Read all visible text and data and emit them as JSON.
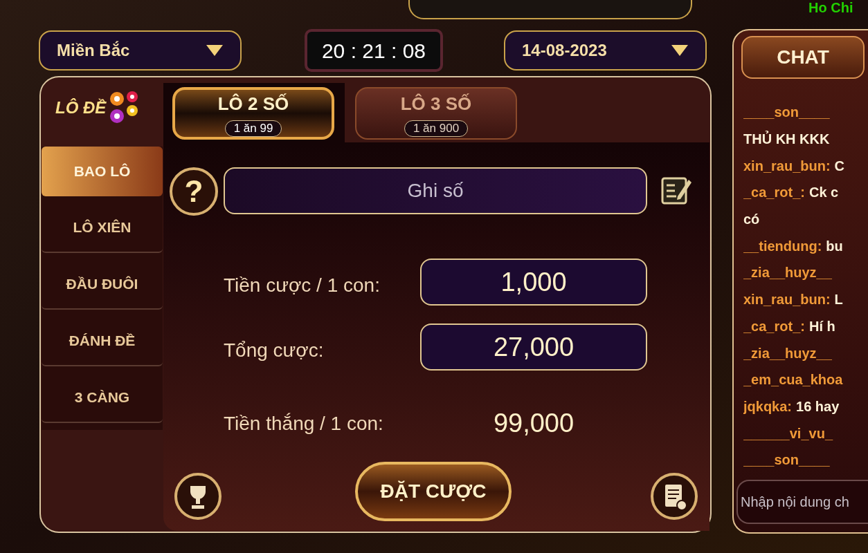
{
  "header": {
    "region": {
      "value": "Miền Bắc"
    },
    "clock": "20 : 21 : 08",
    "date": {
      "value": "14-08-2023"
    },
    "location_text": "Ho Chi"
  },
  "logo": {
    "text": "LÔ ĐỀ"
  },
  "tabs": [
    {
      "label": "LÔ 2 SỐ",
      "odds": "1 ăn 99",
      "selected": true
    },
    {
      "label": "LÔ 3 SỐ",
      "odds": "1 ăn 900",
      "selected": false
    }
  ],
  "sidebar": {
    "items": [
      {
        "label": "BAO LÔ",
        "selected": true
      },
      {
        "label": "LÔ XIÊN",
        "selected": false
      },
      {
        "label": "ĐẦU ĐUÔI",
        "selected": false
      },
      {
        "label": "ĐÁNH ĐỀ",
        "selected": false
      },
      {
        "label": "3 CÀNG",
        "selected": false
      }
    ]
  },
  "help_button": "?",
  "number_input": {
    "placeholder": "Ghi số"
  },
  "form": [
    {
      "label": "Tiền cược / 1 con:",
      "value": "1,000",
      "kind": "field"
    },
    {
      "label": "Tổng cược:",
      "value": "27,000",
      "kind": "field"
    },
    {
      "label": "Tiền thắng / 1 con:",
      "value": "99,000",
      "kind": "text"
    }
  ],
  "bet_button": "ĐẶT CƯỢC",
  "chat": {
    "title": "CHAT",
    "messages": [
      {
        "user": "____son____"
      },
      {
        "text": "THỦ KH KKK"
      },
      {
        "user": "xin_rau_bun:",
        "text": "C"
      },
      {
        "user": "_ca_rot_:",
        "text": "Ck c"
      },
      {
        "text": "có"
      },
      {
        "user": "__tiendung:",
        "text": "bu"
      },
      {
        "user": "_zia__huyz__"
      },
      {
        "user": "xin_rau_bun:",
        "text": "L"
      },
      {
        "user": "_ca_rot_:",
        "text": "Hí h"
      },
      {
        "user": "_zia__huyz__"
      },
      {
        "user": "_em_cua_khoa"
      },
      {
        "user": "jqkqka:",
        "text": "16 hay"
      },
      {
        "user": "______vi_vu_"
      },
      {
        "user": "____son____"
      }
    ],
    "input": {
      "placeholder": "Nhập nội dung ch"
    }
  }
}
